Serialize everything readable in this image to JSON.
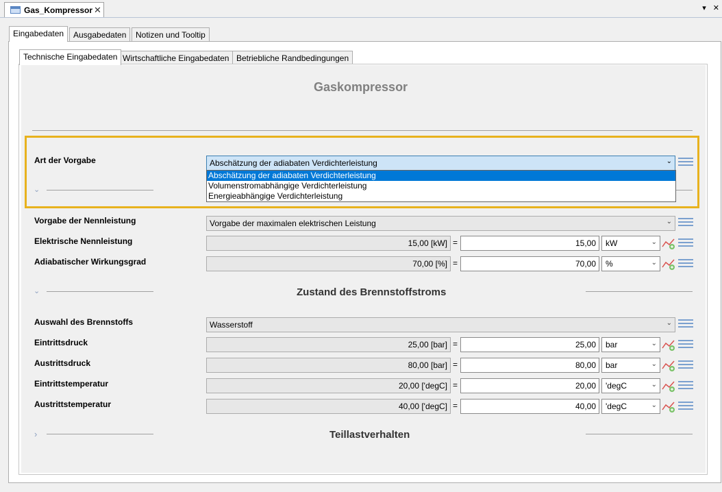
{
  "document_tab": {
    "title": "Gas_Kompressor",
    "close": "✕"
  },
  "window_controls": {
    "menu": "▾",
    "close": "✕"
  },
  "outer_tabs": [
    "Eingabedaten",
    "Ausgabedaten",
    "Notizen und Tooltip"
  ],
  "inner_tabs": [
    "Technische Eingabedaten",
    "Wirtschaftliche Eingabedaten",
    "Betriebliche Randbedingungen"
  ],
  "heading": "Gaskompressor",
  "art_der_vorgabe": {
    "label": "Art der Vorgabe",
    "selected": "Abschätzung der adiabaten Verdichterleistung",
    "options": [
      "Abschätzung der adiabaten Verdichterleistung",
      "Volumenstromabhängige Verdichterleistung",
      "Energieabhängige Verdichterleistung"
    ]
  },
  "vorgabe_nennleistung": {
    "label": "Vorgabe der Nennleistung",
    "value": "Vorgabe der maximalen elektrischen Leistung"
  },
  "rows_power": [
    {
      "label": "Elektrische Nennleistung",
      "readonly": "15,00 [kW]",
      "eq": "=",
      "value": "15,00",
      "unit": "kW"
    },
    {
      "label": "Adiabatischer Wirkungsgrad",
      "readonly": "70,00 [%]",
      "eq": "=",
      "value": "70,00",
      "unit": "%"
    }
  ],
  "section_brennstoff": {
    "title": "Zustand des Brennstoffstroms",
    "fuel_label": "Auswahl des Brennstoffs",
    "fuel_value": "Wasserstoff",
    "rows": [
      {
        "label": "Eintrittsdruck",
        "readonly": "25,00 [bar]",
        "eq": "=",
        "value": "25,00",
        "unit": "bar"
      },
      {
        "label": "Austrittsdruck",
        "readonly": "80,00 [bar]",
        "eq": "=",
        "value": "80,00",
        "unit": "bar"
      },
      {
        "label": "Eintrittstemperatur",
        "readonly": "20,00 ['degC]",
        "eq": "=",
        "value": "20,00",
        "unit": "'degC"
      },
      {
        "label": "Austrittstemperatur",
        "readonly": "40,00 ['degC]",
        "eq": "=",
        "value": "40,00",
        "unit": "'degC"
      }
    ]
  },
  "section_teillast": {
    "title": "Teillastverhalten"
  },
  "colors": {
    "accent_highlight": "#e8b21e",
    "selection": "#0078d7",
    "heading_grey": "#808080"
  },
  "icons": {
    "list": "list-icon",
    "chart": "chart-edit-icon",
    "collapse": "chevron-down-icon",
    "expand": "chevron-right-icon"
  }
}
